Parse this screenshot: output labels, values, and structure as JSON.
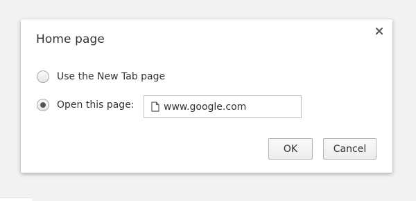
{
  "dialog": {
    "title": "Home page",
    "close_icon": "close-icon"
  },
  "options": [
    {
      "label": "Use the New Tab page",
      "selected": false
    },
    {
      "label": "Open this page:",
      "selected": true
    }
  ],
  "url_field": {
    "icon": "page-icon",
    "value": "www.google.com"
  },
  "buttons": {
    "ok_label": "OK",
    "cancel_label": "Cancel"
  }
}
